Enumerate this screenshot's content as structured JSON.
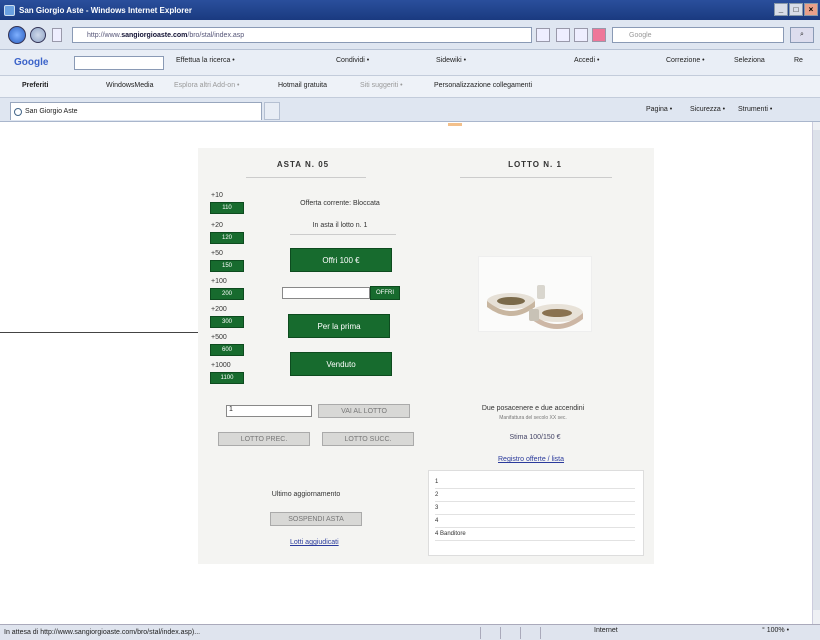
{
  "window": {
    "title": "San Giorgio Aste - Windows Internet Explorer",
    "controls": [
      "_",
      "□",
      "×"
    ]
  },
  "address": {
    "url_prefix": "http://www.",
    "url_domain": "sangiorgioaste.com",
    "url_path": "/bro/stal/index.asp",
    "search_placeholder": "Google",
    "search_go": "⌕"
  },
  "google_bar": {
    "logo": "Google",
    "items": [
      "Effettua la ricerca •",
      "Condividi •",
      "Sidewiki •",
      "Accedi •",
      "Correzione •",
      "Seleziona",
      "Re"
    ]
  },
  "favorites_bar": {
    "items": [
      "Preferiti",
      "WindowsMedia",
      "Esplora altri Add-on •",
      "Hotmail gratuita",
      "Siti suggeriti •",
      "Personalizzazione collegamenti"
    ]
  },
  "tab": {
    "label": "San Giorgio Aste",
    "tools": [
      "Pagina •",
      "Sicurezza •",
      "Strumenti •"
    ]
  },
  "status": {
    "text": "In attesa di http://www.sangiorgioaste.com/bro/stal/index.asp)...",
    "zone": "Internet",
    "zoom": "° 100% •"
  },
  "auction": {
    "header": "ASTA N. 05",
    "increments": [
      {
        "label": "+10",
        "value": "110"
      },
      {
        "label": "+20",
        "value": "120"
      },
      {
        "label": "+50",
        "value": "150"
      },
      {
        "label": "+100",
        "value": "200"
      },
      {
        "label": "+200",
        "value": "300"
      },
      {
        "label": "+500",
        "value": "600"
      },
      {
        "label": "+1000",
        "value": "1100"
      }
    ],
    "current_offer": "Offerta corrente: Bloccata",
    "lot_line": "In asta il lotto n. 1",
    "offer_button": "Offri 100 €",
    "offer_input": "",
    "offer_go": "OFFRI",
    "first_button": "Per la prima",
    "sold_button": "Venduto",
    "goto_input": "1",
    "goto_button": "VAI AL LOTTO",
    "prev_button": "LOTTO PREC.",
    "next_button": "LOTTO SUCC.",
    "last_update": "Ultimo aggiornamento",
    "suspend_button": "SOSPENDI ASTA",
    "link_bottom": "Lotti aggiudicati"
  },
  "lot": {
    "header": "LOTTO N. 1",
    "title": "Due posacenere e due accendini",
    "subtitle": "Manifattura del secolo XX sec.",
    "estimate": "Stima 100/150 €",
    "link": "Registro offerte / lista",
    "history": [
      "1",
      "2",
      "3",
      "4",
      "4 Banditore"
    ]
  }
}
